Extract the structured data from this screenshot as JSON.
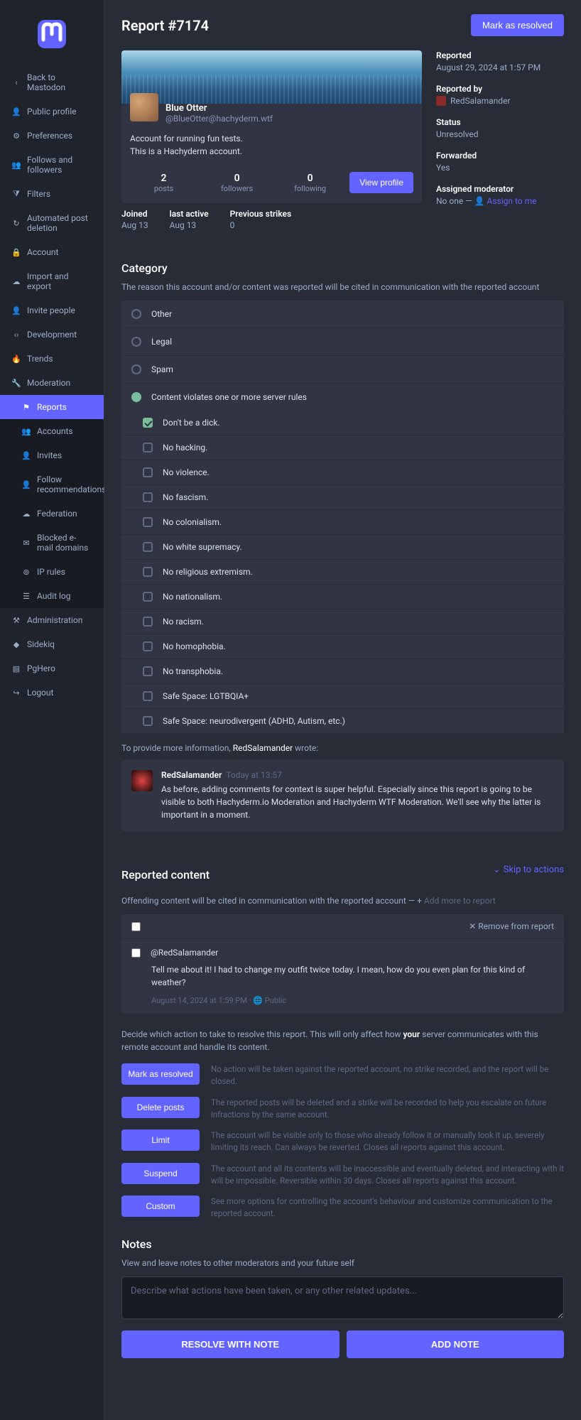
{
  "header": {
    "title": "Report #7174",
    "resolve_btn": "Mark as resolved"
  },
  "nav": {
    "back": "Back to Mastodon",
    "items": [
      "Public profile",
      "Preferences",
      "Follows and followers",
      "Filters",
      "Automated post deletion",
      "Account",
      "Import and export",
      "Invite people",
      "Development",
      "Trends",
      "Moderation"
    ],
    "mod_sub": [
      "Reports",
      "Accounts",
      "Invites",
      "Follow recommendations",
      "Federation",
      "Blocked e-mail domains",
      "IP rules",
      "Audit log"
    ],
    "tail": [
      "Administration",
      "Sidekiq",
      "PgHero",
      "Logout"
    ]
  },
  "profile": {
    "display_name": "Blue Otter",
    "handle": "@BlueOtter@hachyderm.wtf",
    "bio1": "Account for running fun tests.",
    "bio2": "This is a Hachyderm account.",
    "posts_n": "2",
    "posts_l": "posts",
    "followers_n": "0",
    "followers_l": "followers",
    "following_n": "0",
    "following_l": "following",
    "view_btn": "View profile"
  },
  "meta": {
    "joined_l": "Joined",
    "joined_v": "Aug 13",
    "active_l": "last active",
    "active_v": "Aug 13",
    "strikes_l": "Previous strikes",
    "strikes_v": "0"
  },
  "side": {
    "reported_l": "Reported",
    "reported_v": "August 29, 2024 at 1:57 PM",
    "by_l": "Reported by",
    "by_v": "RedSalamander",
    "status_l": "Status",
    "status_v": "Unresolved",
    "fwd_l": "Forwarded",
    "fwd_v": "Yes",
    "mod_l": "Assigned moderator",
    "mod_v": "No one —",
    "mod_link": "Assign to me"
  },
  "category": {
    "title": "Category",
    "desc": "The reason this account and/or content was reported will be cited in communication with the reported account",
    "opts": [
      "Other",
      "Legal",
      "Spam",
      "Content violates one or more server rules"
    ],
    "rules": [
      "Don't be a dick.",
      "No hacking.",
      "No violence.",
      "No fascism.",
      "No colonialism.",
      "No white supremacy.",
      "No religious extremism.",
      "No nationalism.",
      "No racism.",
      "No homophobia.",
      "No transphobia.",
      "Safe Space: LGTBQIA+",
      "Safe Space: neurodivergent (ADHD, Autism, etc.)"
    ]
  },
  "commenter_note": {
    "pre": "To provide more information, ",
    "name": "RedSalamander",
    "post": " wrote:"
  },
  "comment": {
    "author": "RedSalamander",
    "time": "Today at 13:57",
    "text": "As before, adding comments for context is super helpful. Especially since this report is going to be visible to both Hachyderm.io Moderation and Hachyderm WTF Moderation. We'll see why the latter is important in a moment."
  },
  "reported_content": {
    "title": "Reported content",
    "skip": "Skip to actions",
    "desc": "Offending content will be cited in communication with the reported account —",
    "add_more": "Add more to report",
    "remove": "Remove from report",
    "post_author": "@RedSalamander",
    "post_text": "Tell me about it! I had to change my outfit twice today. I mean, how do you even plan for this kind of weather?",
    "post_meta": "August 14, 2024 at 1:59 PM · 🌐 Public"
  },
  "actions": {
    "desc_pre": "Decide which action to take to resolve this report. This will only affect how ",
    "desc_bold": "your",
    "desc_post": " server communicates with this remote account and handle its content.",
    "rows": [
      {
        "btn": "Mark as resolved",
        "txt": "No action will be taken against the reported account, no strike recorded, and the report will be closed."
      },
      {
        "btn": "Delete posts",
        "txt": "The reported posts will be deleted and a strike will be recorded to help you escalate on future infractions by the same account."
      },
      {
        "btn": "Limit",
        "txt": "The account will be visible only to those who already follow it or manually look it up, severely limiting its reach. Can always be reverted. Closes all reports against this account."
      },
      {
        "btn": "Suspend",
        "txt": "The account and all its contents will be inaccessible and eventually deleted, and interacting with it will be impossible. Reversible within 30 days. Closes all reports against this account."
      },
      {
        "btn": "Custom",
        "txt": "See more options for controlling the account's behaviour and customize communication to the reported account."
      }
    ]
  },
  "notes": {
    "title": "Notes",
    "desc": "View and leave notes to other moderators and your future self",
    "placeholder": "Describe what actions have been taken, or any other related updates...",
    "resolve_note": "RESOLVE WITH NOTE",
    "add_note": "ADD NOTE"
  }
}
